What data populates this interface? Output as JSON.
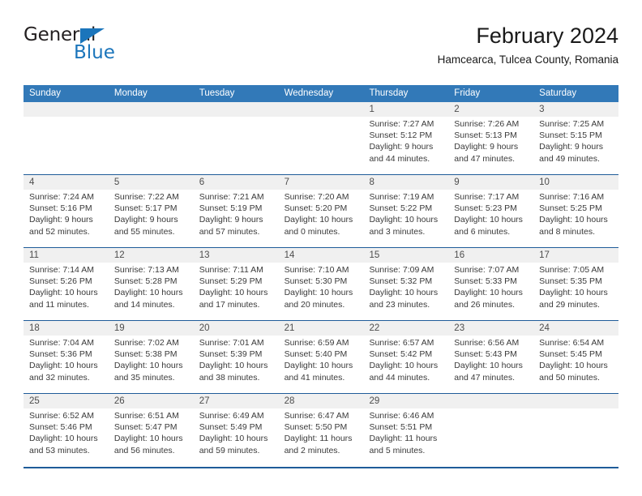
{
  "brand": {
    "name_top": "General",
    "name_bottom": "Blue",
    "triangle_color": "#1b75bb"
  },
  "header": {
    "title": "February 2024",
    "subtitle": "Hamcearca, Tulcea County, Romania"
  },
  "theme": {
    "header_blue": "#3279b8",
    "divider_blue": "#1f5c99",
    "daynum_band": "#f0f0f0",
    "text": "#3a3a3a"
  },
  "weekdays": [
    "Sunday",
    "Monday",
    "Tuesday",
    "Wednesday",
    "Thursday",
    "Friday",
    "Saturday"
  ],
  "weeks": [
    [
      {
        "day": "",
        "lines": [
          "",
          "",
          "",
          ""
        ]
      },
      {
        "day": "",
        "lines": [
          "",
          "",
          "",
          ""
        ]
      },
      {
        "day": "",
        "lines": [
          "",
          "",
          "",
          ""
        ]
      },
      {
        "day": "",
        "lines": [
          "",
          "",
          "",
          ""
        ]
      },
      {
        "day": "1",
        "lines": [
          "Sunrise: 7:27 AM",
          "Sunset: 5:12 PM",
          "Daylight: 9 hours",
          "and 44 minutes."
        ]
      },
      {
        "day": "2",
        "lines": [
          "Sunrise: 7:26 AM",
          "Sunset: 5:13 PM",
          "Daylight: 9 hours",
          "and 47 minutes."
        ]
      },
      {
        "day": "3",
        "lines": [
          "Sunrise: 7:25 AM",
          "Sunset: 5:15 PM",
          "Daylight: 9 hours",
          "and 49 minutes."
        ]
      }
    ],
    [
      {
        "day": "4",
        "lines": [
          "Sunrise: 7:24 AM",
          "Sunset: 5:16 PM",
          "Daylight: 9 hours",
          "and 52 minutes."
        ]
      },
      {
        "day": "5",
        "lines": [
          "Sunrise: 7:22 AM",
          "Sunset: 5:17 PM",
          "Daylight: 9 hours",
          "and 55 minutes."
        ]
      },
      {
        "day": "6",
        "lines": [
          "Sunrise: 7:21 AM",
          "Sunset: 5:19 PM",
          "Daylight: 9 hours",
          "and 57 minutes."
        ]
      },
      {
        "day": "7",
        "lines": [
          "Sunrise: 7:20 AM",
          "Sunset: 5:20 PM",
          "Daylight: 10 hours",
          "and 0 minutes."
        ]
      },
      {
        "day": "8",
        "lines": [
          "Sunrise: 7:19 AM",
          "Sunset: 5:22 PM",
          "Daylight: 10 hours",
          "and 3 minutes."
        ]
      },
      {
        "day": "9",
        "lines": [
          "Sunrise: 7:17 AM",
          "Sunset: 5:23 PM",
          "Daylight: 10 hours",
          "and 6 minutes."
        ]
      },
      {
        "day": "10",
        "lines": [
          "Sunrise: 7:16 AM",
          "Sunset: 5:25 PM",
          "Daylight: 10 hours",
          "and 8 minutes."
        ]
      }
    ],
    [
      {
        "day": "11",
        "lines": [
          "Sunrise: 7:14 AM",
          "Sunset: 5:26 PM",
          "Daylight: 10 hours",
          "and 11 minutes."
        ]
      },
      {
        "day": "12",
        "lines": [
          "Sunrise: 7:13 AM",
          "Sunset: 5:28 PM",
          "Daylight: 10 hours",
          "and 14 minutes."
        ]
      },
      {
        "day": "13",
        "lines": [
          "Sunrise: 7:11 AM",
          "Sunset: 5:29 PM",
          "Daylight: 10 hours",
          "and 17 minutes."
        ]
      },
      {
        "day": "14",
        "lines": [
          "Sunrise: 7:10 AM",
          "Sunset: 5:30 PM",
          "Daylight: 10 hours",
          "and 20 minutes."
        ]
      },
      {
        "day": "15",
        "lines": [
          "Sunrise: 7:09 AM",
          "Sunset: 5:32 PM",
          "Daylight: 10 hours",
          "and 23 minutes."
        ]
      },
      {
        "day": "16",
        "lines": [
          "Sunrise: 7:07 AM",
          "Sunset: 5:33 PM",
          "Daylight: 10 hours",
          "and 26 minutes."
        ]
      },
      {
        "day": "17",
        "lines": [
          "Sunrise: 7:05 AM",
          "Sunset: 5:35 PM",
          "Daylight: 10 hours",
          "and 29 minutes."
        ]
      }
    ],
    [
      {
        "day": "18",
        "lines": [
          "Sunrise: 7:04 AM",
          "Sunset: 5:36 PM",
          "Daylight: 10 hours",
          "and 32 minutes."
        ]
      },
      {
        "day": "19",
        "lines": [
          "Sunrise: 7:02 AM",
          "Sunset: 5:38 PM",
          "Daylight: 10 hours",
          "and 35 minutes."
        ]
      },
      {
        "day": "20",
        "lines": [
          "Sunrise: 7:01 AM",
          "Sunset: 5:39 PM",
          "Daylight: 10 hours",
          "and 38 minutes."
        ]
      },
      {
        "day": "21",
        "lines": [
          "Sunrise: 6:59 AM",
          "Sunset: 5:40 PM",
          "Daylight: 10 hours",
          "and 41 minutes."
        ]
      },
      {
        "day": "22",
        "lines": [
          "Sunrise: 6:57 AM",
          "Sunset: 5:42 PM",
          "Daylight: 10 hours",
          "and 44 minutes."
        ]
      },
      {
        "day": "23",
        "lines": [
          "Sunrise: 6:56 AM",
          "Sunset: 5:43 PM",
          "Daylight: 10 hours",
          "and 47 minutes."
        ]
      },
      {
        "day": "24",
        "lines": [
          "Sunrise: 6:54 AM",
          "Sunset: 5:45 PM",
          "Daylight: 10 hours",
          "and 50 minutes."
        ]
      }
    ],
    [
      {
        "day": "25",
        "lines": [
          "Sunrise: 6:52 AM",
          "Sunset: 5:46 PM",
          "Daylight: 10 hours",
          "and 53 minutes."
        ]
      },
      {
        "day": "26",
        "lines": [
          "Sunrise: 6:51 AM",
          "Sunset: 5:47 PM",
          "Daylight: 10 hours",
          "and 56 minutes."
        ]
      },
      {
        "day": "27",
        "lines": [
          "Sunrise: 6:49 AM",
          "Sunset: 5:49 PM",
          "Daylight: 10 hours",
          "and 59 minutes."
        ]
      },
      {
        "day": "28",
        "lines": [
          "Sunrise: 6:47 AM",
          "Sunset: 5:50 PM",
          "Daylight: 11 hours",
          "and 2 minutes."
        ]
      },
      {
        "day": "29",
        "lines": [
          "Sunrise: 6:46 AM",
          "Sunset: 5:51 PM",
          "Daylight: 11 hours",
          "and 5 minutes."
        ]
      },
      {
        "day": "",
        "lines": [
          "",
          "",
          "",
          ""
        ]
      },
      {
        "day": "",
        "lines": [
          "",
          "",
          "",
          ""
        ]
      }
    ]
  ]
}
